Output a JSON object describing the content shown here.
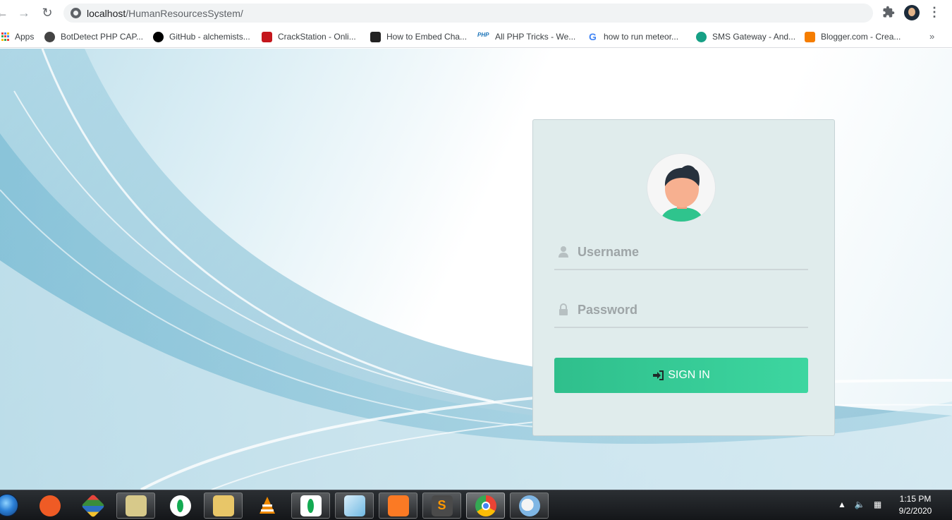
{
  "browser": {
    "url_host": "localhost",
    "url_path": "/HumanResourcesSystem/",
    "back_icon": "arrow-left-icon",
    "forward_icon": "arrow-right-icon",
    "reload_icon": "reload-icon"
  },
  "bookmarks": {
    "apps_label": "Apps",
    "items": [
      {
        "label": "BotDetect PHP CAP...",
        "icon": "botdetect-icon",
        "color": "#444444"
      },
      {
        "label": "GitHub - alchemists...",
        "icon": "github-icon",
        "color": "#000000"
      },
      {
        "label": "CrackStation - Onli...",
        "icon": "crackstation-icon",
        "color": "#c4161c"
      },
      {
        "label": "How to Embed Cha...",
        "icon": "ch-icon",
        "color": "#222222"
      },
      {
        "label": "All PHP Tricks - We...",
        "icon": "php-icon",
        "color": "#1a73b8"
      },
      {
        "label": "how to run meteor...",
        "icon": "google-icon",
        "color": "#4285f4"
      },
      {
        "label": "SMS Gateway - And...",
        "icon": "sms-gateway-icon",
        "color": "#16a085"
      },
      {
        "label": "Blogger.com - Crea...",
        "icon": "blogger-icon",
        "color": "#f57d00"
      }
    ],
    "more_label": "»"
  },
  "login": {
    "username_placeholder": "Username",
    "password_placeholder": "Password",
    "signin_label": "SIGN IN",
    "accent_color": "#34c995"
  },
  "taskbar": {
    "apps": [
      {
        "name": "postman",
        "color": "#ef5b25"
      },
      {
        "name": "git",
        "color": "#3a8d3a"
      },
      {
        "name": "folders",
        "color": "#d7c98a"
      },
      {
        "name": "mongodb-compass",
        "color": "#ffffff"
      },
      {
        "name": "file-explorer",
        "color": "#e8c668"
      },
      {
        "name": "vlc",
        "color": "#f08a00"
      },
      {
        "name": "mongodb",
        "color": "#ffffff"
      },
      {
        "name": "notepad",
        "color": "#6fb8e2"
      },
      {
        "name": "xampp",
        "color": "#fb7a24"
      },
      {
        "name": "sublime-text",
        "color": "#4a4a4a"
      },
      {
        "name": "chrome",
        "color": "#4285f4"
      },
      {
        "name": "paint",
        "color": "#7fb6e4"
      }
    ],
    "time": "1:15 PM",
    "date": "9/2/2020"
  }
}
